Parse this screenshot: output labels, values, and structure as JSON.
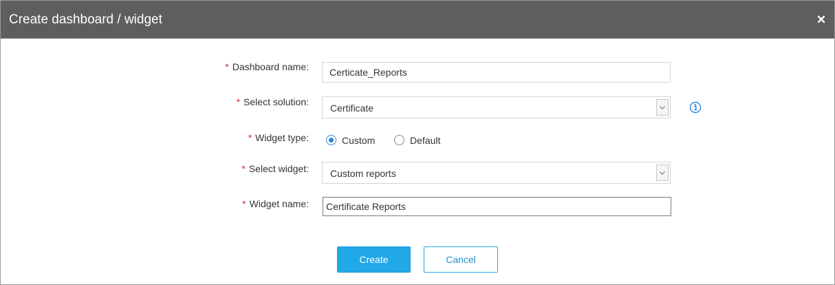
{
  "dialog": {
    "title": "Create dashboard / widget",
    "close_symbol": "×"
  },
  "form": {
    "required_mark": "*",
    "dashboard_name": {
      "label": "Dashboard name:",
      "value": "Certicate_Reports"
    },
    "solution": {
      "label": "Select solution:",
      "selected": "Certificate",
      "info_icon": "info-circle-icon"
    },
    "widget_type": {
      "label": "Widget type:",
      "options": [
        "Custom",
        "Default"
      ],
      "selected": "Custom"
    },
    "widget": {
      "label": "Select widget:",
      "selected": "Custom reports"
    },
    "widget_name": {
      "label": "Widget name:",
      "value": "Certificate Reports"
    }
  },
  "buttons": {
    "create": "Create",
    "cancel": "Cancel"
  },
  "colors": {
    "titlebar": "#5e5e5e",
    "required": "#e0262b",
    "primary": "#21a8e6",
    "info": "#2b86d9"
  }
}
